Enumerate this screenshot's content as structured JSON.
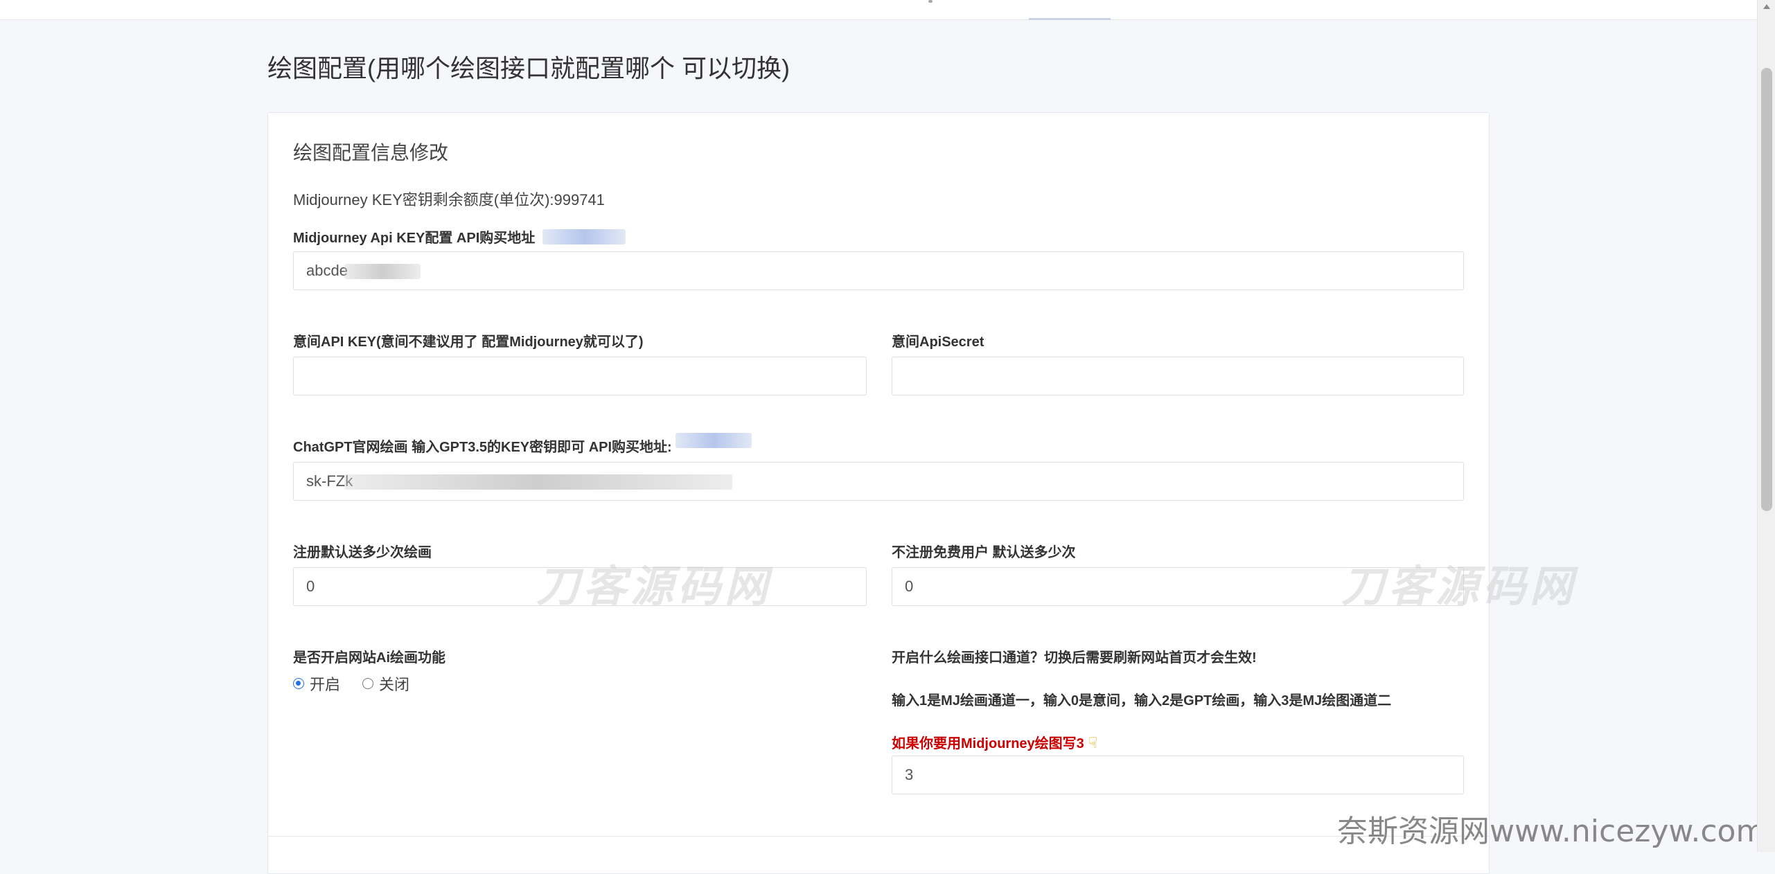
{
  "page": {
    "title": "绘图配置(用哪个绘图接口就配置哪个 可以切换)"
  },
  "card": {
    "title": "绘图配置信息修改",
    "quota_text": "Midjourney KEY密钥剩余额度(单位次):999741"
  },
  "fields": {
    "mj_key": {
      "label": "Midjourney Api KEY配置 API购买地址",
      "value": "abcde"
    },
    "yijian_key": {
      "label": "意间API KEY(意间不建议用了 配置Midjourney就可以了)",
      "value": ""
    },
    "yijian_secret": {
      "label": "意间ApiSecret",
      "value": ""
    },
    "gpt_key": {
      "label": "ChatGPT官网绘画 输入GPT3.5的KEY密钥即可 API购买地址:",
      "value": "sk-FZk"
    },
    "reg_free": {
      "label": "注册默认送多少次绘画",
      "value": "0"
    },
    "unreg_free": {
      "label": "不注册免费用户 默认送多少次",
      "value": "0"
    },
    "ai_enable": {
      "label": "是否开启网站Ai绘画功能",
      "options": [
        "开启",
        "关闭"
      ],
      "selected": "开启"
    },
    "channel": {
      "label": "开启什么绘画接口通道？切换后需要刷新网站首页才会生效!",
      "help": "输入1是MJ绘画通道一，输入0是意间，输入2是GPT绘画，输入3是MJ绘图通道二",
      "hint": "如果你要用Midjourney绘图写3",
      "value": "3"
    }
  },
  "watermarks": {
    "center": "刀客源码网",
    "right": "刀客源码网",
    "corner": "奈斯资源网www.nicezyw.com"
  },
  "colors": {
    "accent": "#1a73e8",
    "hint_red": "#cc0000",
    "background": "#f5f7fa"
  },
  "icons": {
    "hint": "pointing-hand-icon"
  }
}
